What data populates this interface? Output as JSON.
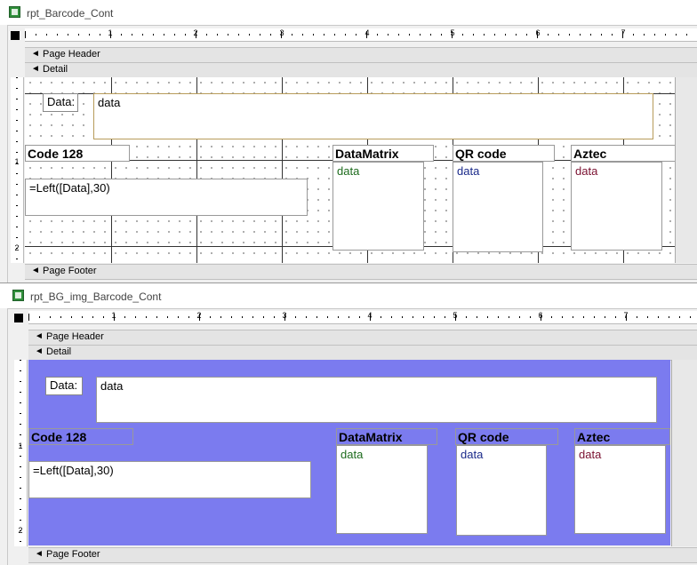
{
  "windows": [
    {
      "title": "rpt_Barcode_Cont",
      "sections": {
        "page_header": "Page Header",
        "detail": "Detail",
        "page_footer": "Page Footer"
      },
      "ruler_h": [
        "1",
        "2",
        "3",
        "4",
        "5",
        "6",
        "7"
      ],
      "ruler_v": [
        "1",
        "2"
      ],
      "controls": {
        "data_label": "Data:",
        "data_field": "data",
        "code128_label": "Code 128",
        "formula": "=Left([Data],30)",
        "datamatrix_label": "DataMatrix",
        "datamatrix_value": "data",
        "qr_label": "QR code",
        "qr_value": "data",
        "aztec_label": "Aztec",
        "aztec_value": "data"
      }
    },
    {
      "title": "rpt_BG_img_Barcode_Cont",
      "sections": {
        "page_header": "Page Header",
        "detail": "Detail",
        "page_footer": "Page Footer"
      },
      "ruler_h": [
        "1",
        "2",
        "3",
        "4",
        "5",
        "6",
        "7"
      ],
      "ruler_v": [
        "1",
        "2"
      ],
      "controls": {
        "data_label": "Data:",
        "data_field": "data",
        "code128_label": "Code 128",
        "formula": "=Left([Data],30)",
        "datamatrix_label": "DataMatrix",
        "datamatrix_value": "data",
        "qr_label": "QR code",
        "qr_value": "data",
        "aztec_label": "Aztec",
        "aztec_value": "data"
      },
      "detail_background": "#7b7bef"
    }
  ],
  "colors": {
    "datamatrix_text": "#1d6b1d",
    "qr_text": "#1a2a8a",
    "aztec_text": "#7a1030"
  },
  "icons": [
    "report-icon",
    "section-collapse-icon"
  ]
}
